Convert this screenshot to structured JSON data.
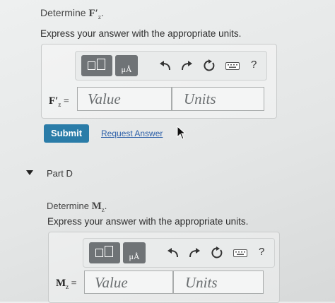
{
  "part_c": {
    "prompt_prefix": "Determine",
    "prompt_symbol": "F′",
    "prompt_subscript": "z",
    "prompt_suffix": ".",
    "instruction": "Express your answer with the appropriate units.",
    "answer_label_symbol": "F′",
    "answer_label_subscript": "z",
    "answer_label_eq": "=",
    "value_placeholder": "Value",
    "units_placeholder": "Units"
  },
  "toolbar": {
    "units_button_label": "μÅ",
    "help_label": "?",
    "icons": [
      "templates-icon",
      "units-icon",
      "undo-icon",
      "redo-icon",
      "reset-icon",
      "keyboard-icon",
      "help-icon"
    ]
  },
  "actions": {
    "submit_label": "Submit",
    "request_answer_label": "Request Answer"
  },
  "part_d": {
    "title": "Part D",
    "prompt_prefix": "Determine",
    "prompt_symbol": "M",
    "prompt_subscript": "z",
    "prompt_suffix": ".",
    "instruction": "Express your answer with the appropriate units.",
    "answer_label_symbol": "M",
    "answer_label_subscript": "z",
    "answer_label_eq": "=",
    "value_placeholder": "Value",
    "units_placeholder": "Units"
  },
  "colors": {
    "submit_bg": "#2a7ca8",
    "link": "#2c5fa8",
    "toolbar_button": "#6f7376"
  }
}
